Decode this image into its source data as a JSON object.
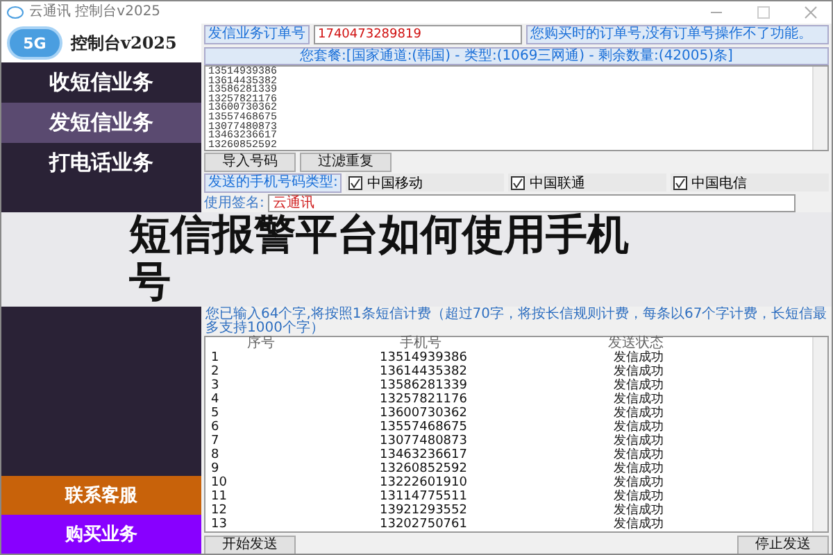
{
  "window": {
    "title": "云通讯 控制台v2025"
  },
  "sidebar": {
    "logo_badge": "5G",
    "logo_title": "控制台v2025",
    "items": [
      {
        "label": "收短信业务",
        "selected": false
      },
      {
        "label": "发短信业务",
        "selected": true
      },
      {
        "label": "打电话业务",
        "selected": false
      }
    ],
    "bottom_items": [
      {
        "label": "联系客服",
        "color": "#c8620a"
      },
      {
        "label": "购买业务",
        "color": "#8800ff"
      }
    ]
  },
  "order": {
    "label": "发信业务订单号",
    "value": "1740473289819",
    "hint": "您购买时的订单号,没有订单号操作不了功能。"
  },
  "package_info": "您套餐:[国家通道:(韩国) - 类型:(1069三网通) - 剩余数量:(42005)条]",
  "phone_list": [
    "13514939386",
    "13614435382",
    "13586281339",
    "13257821176",
    "13600730362",
    "13557468675",
    "13077480873",
    "13463236617",
    "13260852592"
  ],
  "list_buttons": [
    "导入号码",
    "过滤重复"
  ],
  "carrier_label": "发送的手机号码类型:",
  "carriers": [
    {
      "label": "中国移动",
      "checked": true
    },
    {
      "label": "中国联通",
      "checked": true
    },
    {
      "label": "中国电信",
      "checked": true
    }
  ],
  "signature": {
    "label": "使用签名:",
    "value": "云通讯"
  },
  "banner_title": "短信报警平台如何使用手机号",
  "counter": "您已输入64个字,将按照1条短信计费（超过70字，将按长信规则计费，每条以67个字计费，长短信最多支持1000个字）",
  "table": {
    "columns": [
      "序号",
      "手机号",
      "发送状态"
    ],
    "rows": [
      [
        "1",
        "13514939386",
        "发信成功"
      ],
      [
        "2",
        "13614435382",
        "发信成功"
      ],
      [
        "3",
        "13586281339",
        "发信成功"
      ],
      [
        "4",
        "13257821176",
        "发信成功"
      ],
      [
        "5",
        "13600730362",
        "发信成功"
      ],
      [
        "6",
        "13557468675",
        "发信成功"
      ],
      [
        "7",
        "13077480873",
        "发信成功"
      ],
      [
        "8",
        "13463236617",
        "发信成功"
      ],
      [
        "9",
        "13260852592",
        "发信成功"
      ],
      [
        "10",
        "13222601910",
        "发信成功"
      ],
      [
        "11",
        "13114775511",
        "发信成功"
      ],
      [
        "12",
        "13921293552",
        "发信成功"
      ],
      [
        "13",
        "13202750761",
        "发信成功"
      ]
    ]
  },
  "actions": [
    "开始发送",
    "停止发送"
  ]
}
